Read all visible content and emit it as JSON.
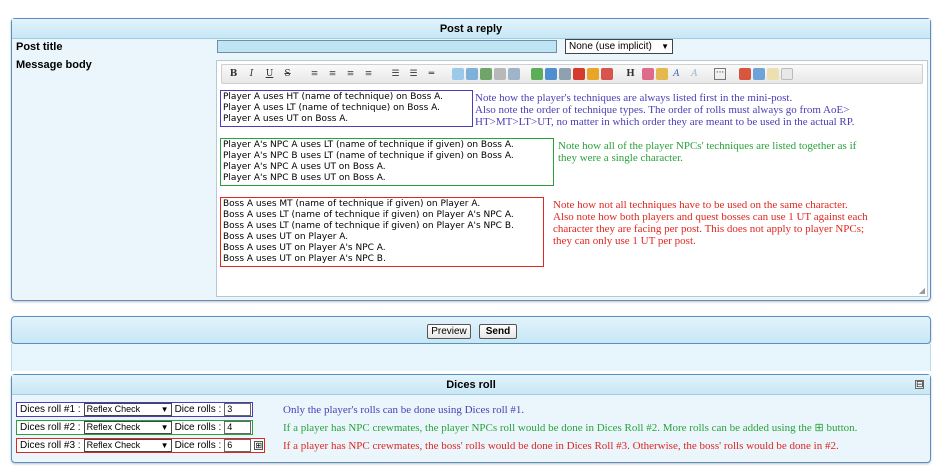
{
  "reply": {
    "header": "Post a reply",
    "title_label": "Post title",
    "title_value": "",
    "implicit_select": "None (use implicit)",
    "body_label": "Message body",
    "toolbar": {
      "bold": "B",
      "italic": "I",
      "underline": "U",
      "strike": "S",
      "icons": [
        "align-left-icon",
        "align-center-icon",
        "align-right-icon",
        "justify-icon",
        "unordered-list-icon",
        "ordered-list-icon",
        "horizontal-rule-icon",
        "quote-icon",
        "image-icon",
        "link-icon",
        "code-icon",
        "spoiler-icon",
        "table-icon",
        "emoticon-icon",
        "youtube-icon",
        "flash-icon",
        "pencil-icon",
        "heading-icon",
        "font-size-icon",
        "color-icon",
        "font-icon",
        "clear-format-icon",
        "more-icon",
        "preview-icon",
        "search-icon",
        "copy-icon",
        "paste-icon"
      ]
    },
    "block1": {
      "lines": [
        "Player A uses HT (name of technique) on Boss A.",
        "Player A uses LT (name of technique) on Boss A.",
        "Player A uses UT on Boss A."
      ],
      "note": [
        "Note how the player's techniques are always listed first in the mini-post.",
        "Also note the order of technique types. The order of rolls must always go from AoE>",
        "HT>MT>LT>UT, no matter in which order they are meant to be used in the actual RP."
      ],
      "color": "#4a3db5"
    },
    "block2": {
      "lines": [
        "Player A's NPC A uses LT (name of technique if given) on Boss A.",
        "Player A's NPC B uses LT (name of technique if given) on Boss A.",
        "Player A's NPC A uses UT on Boss A.",
        "Player A's NPC B uses UT on Boss A."
      ],
      "note": [
        "Note how all of the player NPCs' techniques are listed together as if",
        "they were a single character."
      ],
      "color": "#2aa13a"
    },
    "block3": {
      "lines": [
        "Boss A uses MT (name of technique if given) on Player A.",
        "Boss A uses LT (name of technique if given) on Player A's NPC A.",
        "Boss A uses LT (name of technique if given) on Player A's NPC B.",
        "Boss A uses UT on Player A.",
        "Boss A uses UT on Player A's NPC A.",
        "Boss A uses UT on Player A's NPC B."
      ],
      "note": [
        "Note how not all techniques have to be used on the same character.",
        "Also note how both players and quest bosses can use 1 UT against each",
        "character they are facing per post. This does not apply to player NPCs;",
        "they can only use 1 UT per post."
      ],
      "color": "#e0261f"
    }
  },
  "submit": {
    "preview": "Preview",
    "send": "Send"
  },
  "dice": {
    "header": "Dices roll",
    "collapse": "⊟",
    "rows": [
      {
        "label": "Dices roll #1 :",
        "check": "Reflex Check",
        "rolls_label": "Dice rolls :",
        "rolls": "3",
        "note": "Only the player's rolls can be done using Dices roll #1.",
        "color": "#4a3db5"
      },
      {
        "label": "Dices roll #2 :",
        "check": "Reflex Check",
        "rolls_label": "Dice rolls :",
        "rolls": "4",
        "note": "If a player has NPC crewmates, the player NPCs roll would be done in Dices Roll #2. More rolls can be added using the ⊞ button.",
        "color": "#2aa13a"
      },
      {
        "label": "Dices roll #3 :",
        "check": "Reflex Check",
        "rolls_label": "Dice rolls :",
        "rolls": "6",
        "note": "If a player has NPC crewmates, the boss' rolls would be done in Dices Roll #3. Otherwise, the boss' rolls would be done in #2.",
        "color": "#e0261f"
      }
    ],
    "add_button": "⊞"
  }
}
